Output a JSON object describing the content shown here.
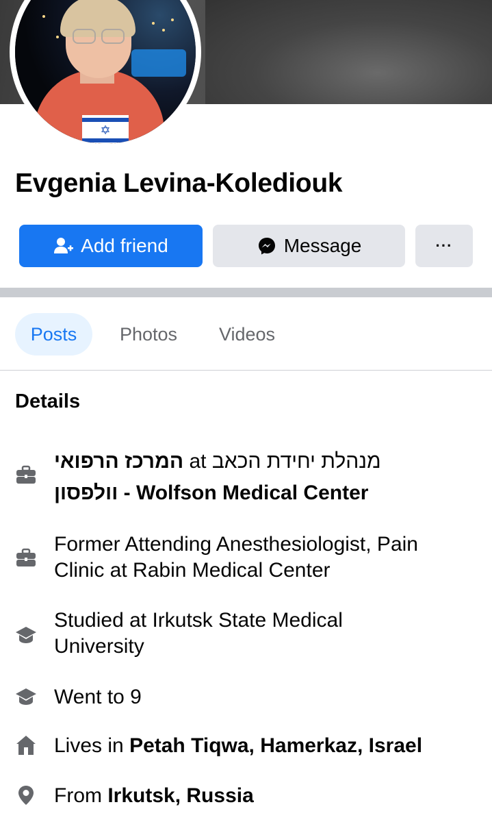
{
  "profile": {
    "name": "Evgenia Levina-Kolediouk"
  },
  "actions": {
    "add_friend_label": "Add friend",
    "message_label": "Message",
    "more_label": "···"
  },
  "tabs": [
    {
      "label": "Posts",
      "active": true
    },
    {
      "label": "Photos",
      "active": false
    },
    {
      "label": "Videos",
      "active": false
    }
  ],
  "details": {
    "title": "Details",
    "items": [
      {
        "icon": "briefcase-icon",
        "line1_rtl": "מנהלת יחידת הכאב",
        "line1_at": "at",
        "line1_bold": "המרכז הרפואי",
        "line2_bold": "וולפסון - Wolfson Medical Center"
      },
      {
        "icon": "briefcase-icon",
        "line1": "Former Attending Anesthesiologist, Pain",
        "line2": "Clinic at Rabin Medical Center"
      },
      {
        "icon": "graduation-cap-icon",
        "line1": "Studied at Irkutsk State Medical",
        "line2": "University"
      },
      {
        "icon": "graduation-cap-icon",
        "line1": "Went to 9"
      },
      {
        "icon": "home-icon",
        "prefix": "Lives in",
        "bold": "Petah Tiqwa, Hamerkaz, Israel"
      },
      {
        "icon": "location-pin-icon",
        "prefix": "From",
        "bold": "Irkutsk, Russia"
      }
    ]
  },
  "colors": {
    "primary": "#1877f2",
    "secondary_button": "#e4e6eb",
    "icon_gray": "#65676b",
    "active_tab_bg": "#e7f3ff"
  }
}
